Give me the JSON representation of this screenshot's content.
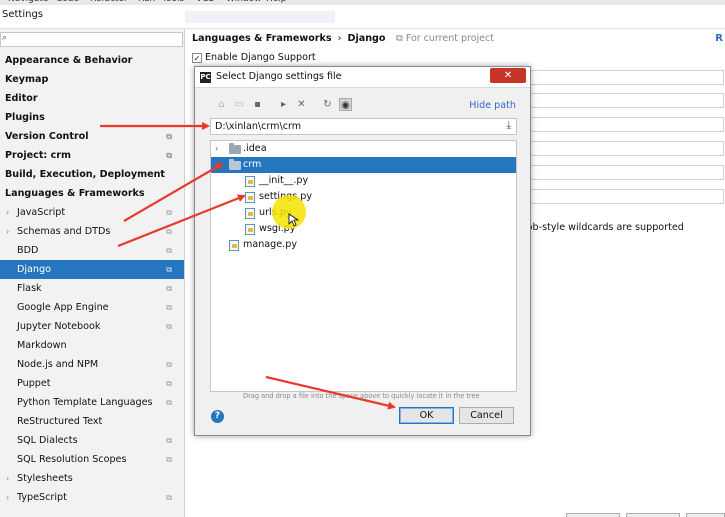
{
  "menubar": [
    "Navigate",
    "Code",
    "Refactor",
    "Run",
    "Tools",
    "VCS",
    "Window",
    "Help"
  ],
  "window": {
    "title": "Settings"
  },
  "search": {
    "icon": "search-icon",
    "placeholder": ""
  },
  "tree": [
    {
      "label": "Appearance & Behavior",
      "level": 0,
      "expandable": true
    },
    {
      "label": "Keymap",
      "level": 0
    },
    {
      "label": "Editor",
      "level": 0,
      "expandable": true
    },
    {
      "label": "Plugins",
      "level": 0
    },
    {
      "label": "Version Control",
      "level": 0,
      "expandable": true,
      "project": true
    },
    {
      "label": "Project: crm",
      "level": 0,
      "expandable": true,
      "project": true
    },
    {
      "label": "Build, Execution, Deployment",
      "level": 0,
      "expandable": true
    },
    {
      "label": "Languages & Frameworks",
      "level": 0,
      "expandable": true
    },
    {
      "label": "JavaScript",
      "level": 1,
      "expandable": true,
      "project": true
    },
    {
      "label": "Schemas and DTDs",
      "level": 1,
      "expandable": true,
      "project": true
    },
    {
      "label": "BDD",
      "level": 1,
      "project": true
    },
    {
      "label": "Django",
      "level": 1,
      "project": true,
      "selected": true
    },
    {
      "label": "Flask",
      "level": 1,
      "project": true
    },
    {
      "label": "Google App Engine",
      "level": 1,
      "project": true
    },
    {
      "label": "Jupyter Notebook",
      "level": 1,
      "project": true
    },
    {
      "label": "Markdown",
      "level": 1
    },
    {
      "label": "Node.js and NPM",
      "level": 1,
      "project": true
    },
    {
      "label": "Puppet",
      "level": 1,
      "project": true
    },
    {
      "label": "Python Template Languages",
      "level": 1,
      "project": true
    },
    {
      "label": "ReStructured Text",
      "level": 1
    },
    {
      "label": "SQL Dialects",
      "level": 1,
      "project": true
    },
    {
      "label": "SQL Resolution Scopes",
      "level": 1,
      "project": true
    },
    {
      "label": "Stylesheets",
      "level": 1,
      "expandable": true
    },
    {
      "label": "TypeScript",
      "level": 1,
      "expandable": true,
      "project": true
    }
  ],
  "right": {
    "crumb_parent": "Languages & Frameworks",
    "crumb_sep": "›",
    "crumb_current": "Django",
    "scope_hint": "For current project",
    "reset_link": "R",
    "enable_label": "Enable Django Support",
    "glob_note": "lob-style wildcards are supported"
  },
  "dialog": {
    "title": "Select Django settings file",
    "close_glyph": "✕",
    "hide_path": "Hide path",
    "path_value": "D:\\xinlan\\crm\\crm",
    "files": [
      {
        "label": ".idea",
        "type": "folder",
        "depth": 0,
        "expanded": false
      },
      {
        "label": "crm",
        "type": "folder",
        "depth": 0,
        "expanded": true,
        "selected": true
      },
      {
        "label": "__init__.py",
        "type": "python",
        "depth": 1
      },
      {
        "label": "settings.py",
        "type": "python",
        "depth": 1
      },
      {
        "label": "urls.py",
        "type": "python",
        "depth": 1
      },
      {
        "label": "wsgi.py",
        "type": "python",
        "depth": 1
      },
      {
        "label": "manage.py",
        "type": "python",
        "depth": 0
      }
    ],
    "drag_note": "Drag and drop a file into the space above to quickly locate it in the tree",
    "help_glyph": "?",
    "ok_label": "OK",
    "cancel_label": "Cancel"
  },
  "toolbar_icons": [
    "home-icon",
    "desktop-icon",
    "project-folder-icon",
    "new-folder-icon",
    "delete-icon",
    "refresh-icon",
    "show-hidden-icon"
  ],
  "colors": {
    "selection": "#2675bf",
    "link": "#2d6bc8",
    "arrow": "#e8392c",
    "highlight": "#f5e400"
  }
}
